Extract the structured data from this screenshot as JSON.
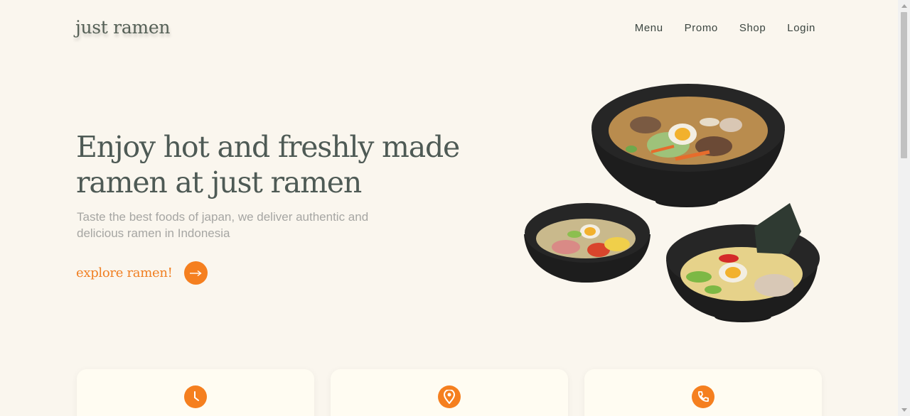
{
  "header": {
    "logo": "just ramen",
    "nav": [
      "Menu",
      "Promo",
      "Shop",
      "Login"
    ]
  },
  "hero": {
    "title": "Enjoy hot and freshly made ramen at just ramen",
    "subtitle": "Taste the best foods of japan, we deliver authentic and delicious ramen in Indonesia",
    "cta_label": "explore ramen!",
    "cta_icon": "arrow-right-icon"
  },
  "cards": [
    {
      "icon": "clock-icon"
    },
    {
      "icon": "location-pin-icon"
    },
    {
      "icon": "phone-icon"
    }
  ],
  "colors": {
    "background": "#faf6ee",
    "accent": "#f57f1f",
    "heading": "#4e5a55",
    "muted": "#a6a6a3",
    "card": "#fffcf2"
  }
}
